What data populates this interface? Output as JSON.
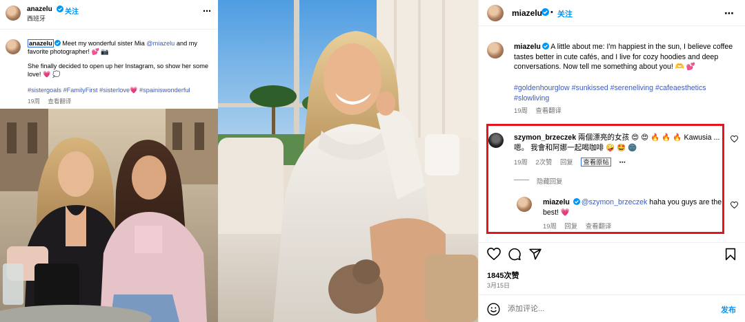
{
  "left_post": {
    "username": "anazelu",
    "follow_label": "关注",
    "location": "西班牙",
    "more_icon": "⋯",
    "caption": {
      "username": "anazelu",
      "text_1": " Meet my wonderful sister Mia ",
      "mention": "@miazelu",
      "text_2": " and my favorite photographer! 💕 📷",
      "text_3": "She finally decided to open up her Instagram, so show her some love! 💗 💭"
    },
    "hashtags": "#sistergoals #FamilyFirst #sisterlove💗 #spainiswonderful",
    "time": "19周",
    "translate": "查看翻译"
  },
  "right_post": {
    "username": "miazelu",
    "dot": "•",
    "follow_label": "关注",
    "more_icon": "⋯",
    "caption": {
      "username": "miazelu",
      "text": " A little about me: I'm happiest in the sun, I believe coffee tastes better in cute cafés, and I live for cozy hoodies and deep conversations. Now tell me something about you! 🫶 💕"
    },
    "hashtags": "#goldenhourglow #sunkissed #sereneliving #cafeaesthetics #slowliving",
    "time": "19周",
    "translate": "查看翻译",
    "comment": {
      "username": "szymon_brzeczek",
      "text": " 兩個漂亮的女孩 😍 😍 🔥 🔥 🔥 Kawusia ... 嗯。 我會和阿娜一起喝咖啡 🤪 🤩 🌚",
      "time": "19周",
      "likes": "2次赞",
      "reply": "回复",
      "view_original": "查看原帖",
      "more": "⋯"
    },
    "hide_replies": "隐藏回复",
    "reply": {
      "username": "miazelu",
      "mention": "@szymon_brzeczek",
      "text": " haha you guys are the best! 💗",
      "time": "19周",
      "reply": "回复",
      "translate": "查看翻译"
    },
    "likes_count": "1845次赞",
    "date": "3月15日",
    "comment_placeholder": "添加评论...",
    "post_label": "发布"
  },
  "icons": {
    "verified": "verified-badge-icon",
    "heart": "heart-icon",
    "comment": "comment-icon",
    "share": "share-icon",
    "save": "bookmark-icon",
    "emoji": "emoji-icon"
  },
  "colors": {
    "accent_blue": "#0095f6",
    "link_blue": "#3a5bc7",
    "highlight_red": "#e3141b",
    "highlight_blue": "#2f6fd6"
  }
}
